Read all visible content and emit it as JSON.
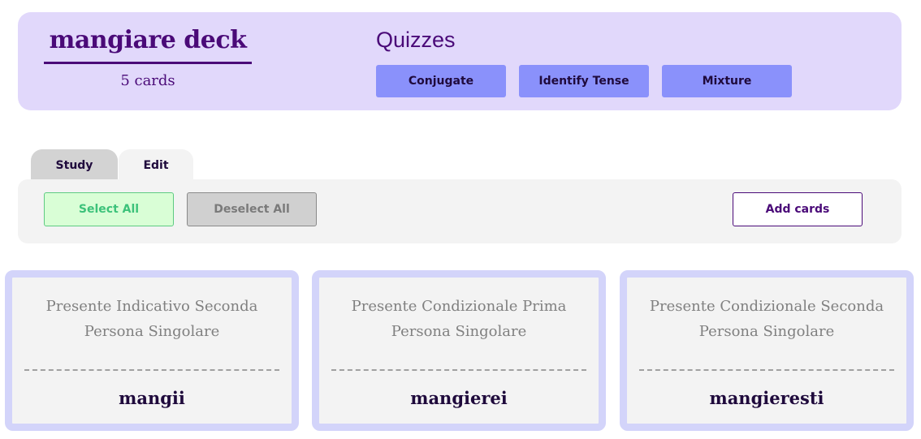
{
  "deck": {
    "title": "mangiare deck",
    "count": "5 cards"
  },
  "quizzes": {
    "title": "Quizzes",
    "buttons": [
      "Conjugate",
      "Identify Tense",
      "Mixture"
    ]
  },
  "tabs": [
    {
      "label": "Study",
      "active": false
    },
    {
      "label": "Edit",
      "active": true
    }
  ],
  "toolbar": {
    "select_all": "Select All",
    "deselect_all": "Deselect All",
    "add_cards": "Add cards"
  },
  "cards": [
    {
      "tense": "Presente Indicativo Seconda Persona Singolare",
      "verb": "mangii"
    },
    {
      "tense": "Presente Condizionale Prima Persona Singolare",
      "verb": "mangierei"
    },
    {
      "tense": "Presente Condizionale Seconda Persona Singolare",
      "verb": "mangieresti"
    }
  ],
  "colors": {
    "header_bg": "#e1d8fb",
    "accent": "#4a0a78",
    "quiz_button": "#8a91fb",
    "card_border": "#d3d4fa",
    "select_green": "#3cc27a"
  }
}
